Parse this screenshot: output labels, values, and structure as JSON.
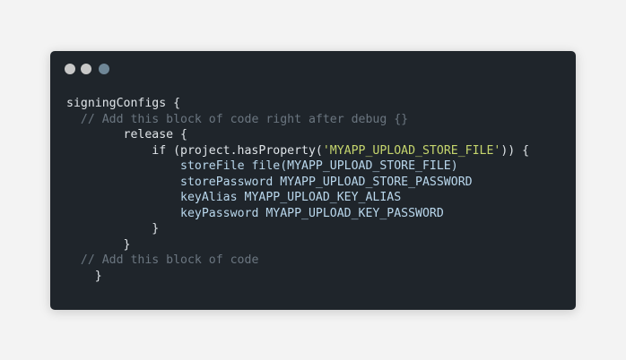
{
  "window": {
    "controls": [
      "close-dot",
      "minimize-dot",
      "maximize-dot"
    ]
  },
  "code": {
    "lines": [
      {
        "indent": "",
        "parts": [
          {
            "t": "signingConfigs {",
            "k": "ident"
          }
        ]
      },
      {
        "indent": "  ",
        "parts": [
          {
            "t": "// Add this block of code right after debug {}",
            "k": "comment"
          }
        ]
      },
      {
        "indent": "        ",
        "parts": [
          {
            "t": "release {",
            "k": "ident"
          }
        ]
      },
      {
        "indent": "            ",
        "parts": [
          {
            "t": "if (project.hasProperty(",
            "k": "ident"
          },
          {
            "t": "'MYAPP_UPLOAD_STORE_FILE'",
            "k": "str"
          },
          {
            "t": ")) {",
            "k": "ident"
          }
        ]
      },
      {
        "indent": "                ",
        "parts": [
          {
            "t": "storeFile file(MYAPP_UPLOAD_STORE_FILE)",
            "k": "const"
          }
        ]
      },
      {
        "indent": "                ",
        "parts": [
          {
            "t": "storePassword MYAPP_UPLOAD_STORE_PASSWORD",
            "k": "const"
          }
        ]
      },
      {
        "indent": "                ",
        "parts": [
          {
            "t": "keyAlias MYAPP_UPLOAD_KEY_ALIAS",
            "k": "const"
          }
        ]
      },
      {
        "indent": "                ",
        "parts": [
          {
            "t": "keyPassword MYAPP_UPLOAD_KEY_PASSWORD",
            "k": "const"
          }
        ]
      },
      {
        "indent": "            ",
        "parts": [
          {
            "t": "}",
            "k": "ident"
          }
        ]
      },
      {
        "indent": "        ",
        "parts": [
          {
            "t": "}",
            "k": "ident"
          }
        ]
      },
      {
        "indent": "  ",
        "parts": [
          {
            "t": "// Add this block of code",
            "k": "comment"
          }
        ]
      },
      {
        "indent": "    ",
        "parts": [
          {
            "t": "}",
            "k": "ident"
          }
        ]
      }
    ]
  }
}
